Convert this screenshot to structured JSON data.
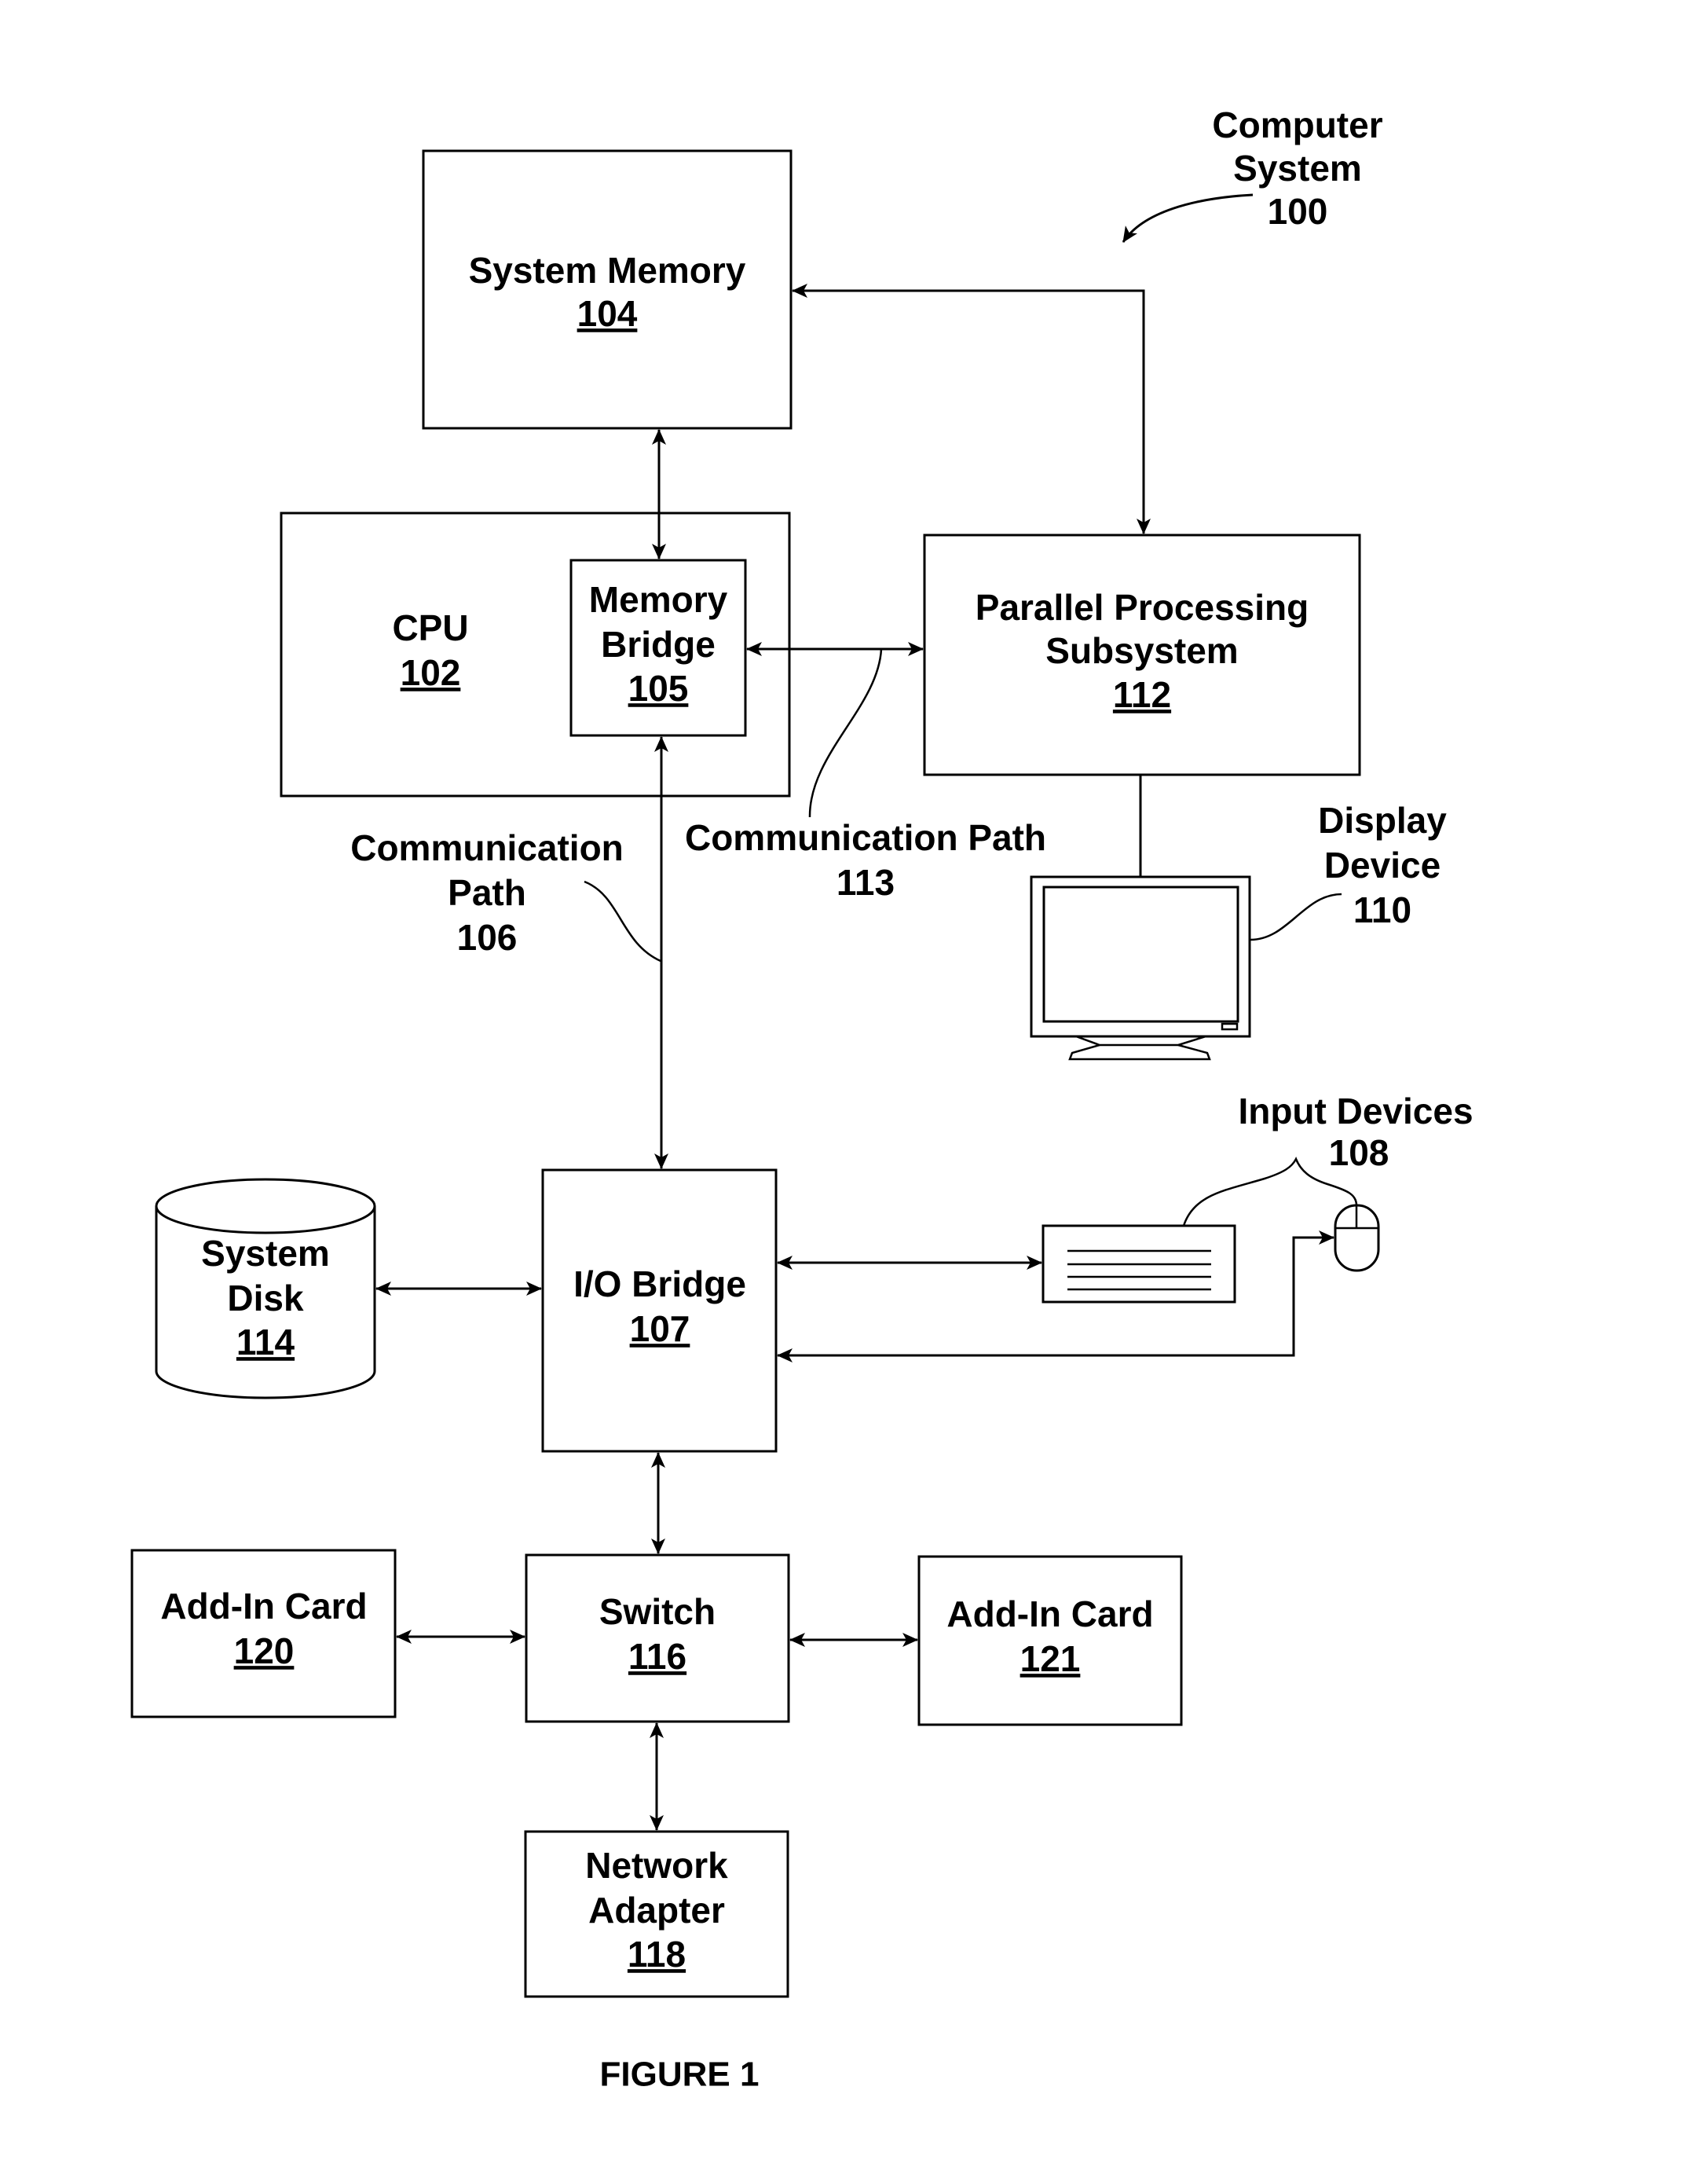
{
  "figure": {
    "caption": "FIGURE 1",
    "system_label": {
      "line1": "Computer",
      "line2": "System",
      "ref": "100"
    }
  },
  "blocks": {
    "system_memory": {
      "lines": [
        "System Memory"
      ],
      "ref": "104"
    },
    "cpu": {
      "lines": [
        "CPU"
      ],
      "ref": "102"
    },
    "memory_bridge": {
      "lines": [
        "Memory",
        "Bridge"
      ],
      "ref": "105"
    },
    "parallel_processing": {
      "lines": [
        "Parallel Processing",
        "Subsystem"
      ],
      "ref": "112"
    },
    "system_disk": {
      "lines": [
        "System",
        "Disk"
      ],
      "ref": "114"
    },
    "io_bridge": {
      "lines": [
        "I/O Bridge"
      ],
      "ref": "107"
    },
    "switch": {
      "lines": [
        "Switch"
      ],
      "ref": "116"
    },
    "add_in_card_120": {
      "lines": [
        "Add-In Card"
      ],
      "ref": "120"
    },
    "add_in_card_121": {
      "lines": [
        "Add-In Card"
      ],
      "ref": "121"
    },
    "network_adapter": {
      "lines": [
        "Network",
        "Adapter"
      ],
      "ref": "118"
    }
  },
  "callouts": {
    "comm_path_106": {
      "lines": [
        "Communication",
        "Path"
      ],
      "ref": "106"
    },
    "comm_path_113": {
      "lines": [
        "Communication Path"
      ],
      "ref": "113"
    },
    "display_device": {
      "lines": [
        "Display",
        "Device"
      ],
      "ref": "110"
    },
    "input_devices": {
      "lines": [
        "Input Devices"
      ],
      "ref": "108"
    }
  },
  "icons": {
    "display": "monitor-icon",
    "keyboard": "keyboard-icon",
    "mouse": "mouse-icon",
    "disk": "disk-cylinder-icon"
  }
}
